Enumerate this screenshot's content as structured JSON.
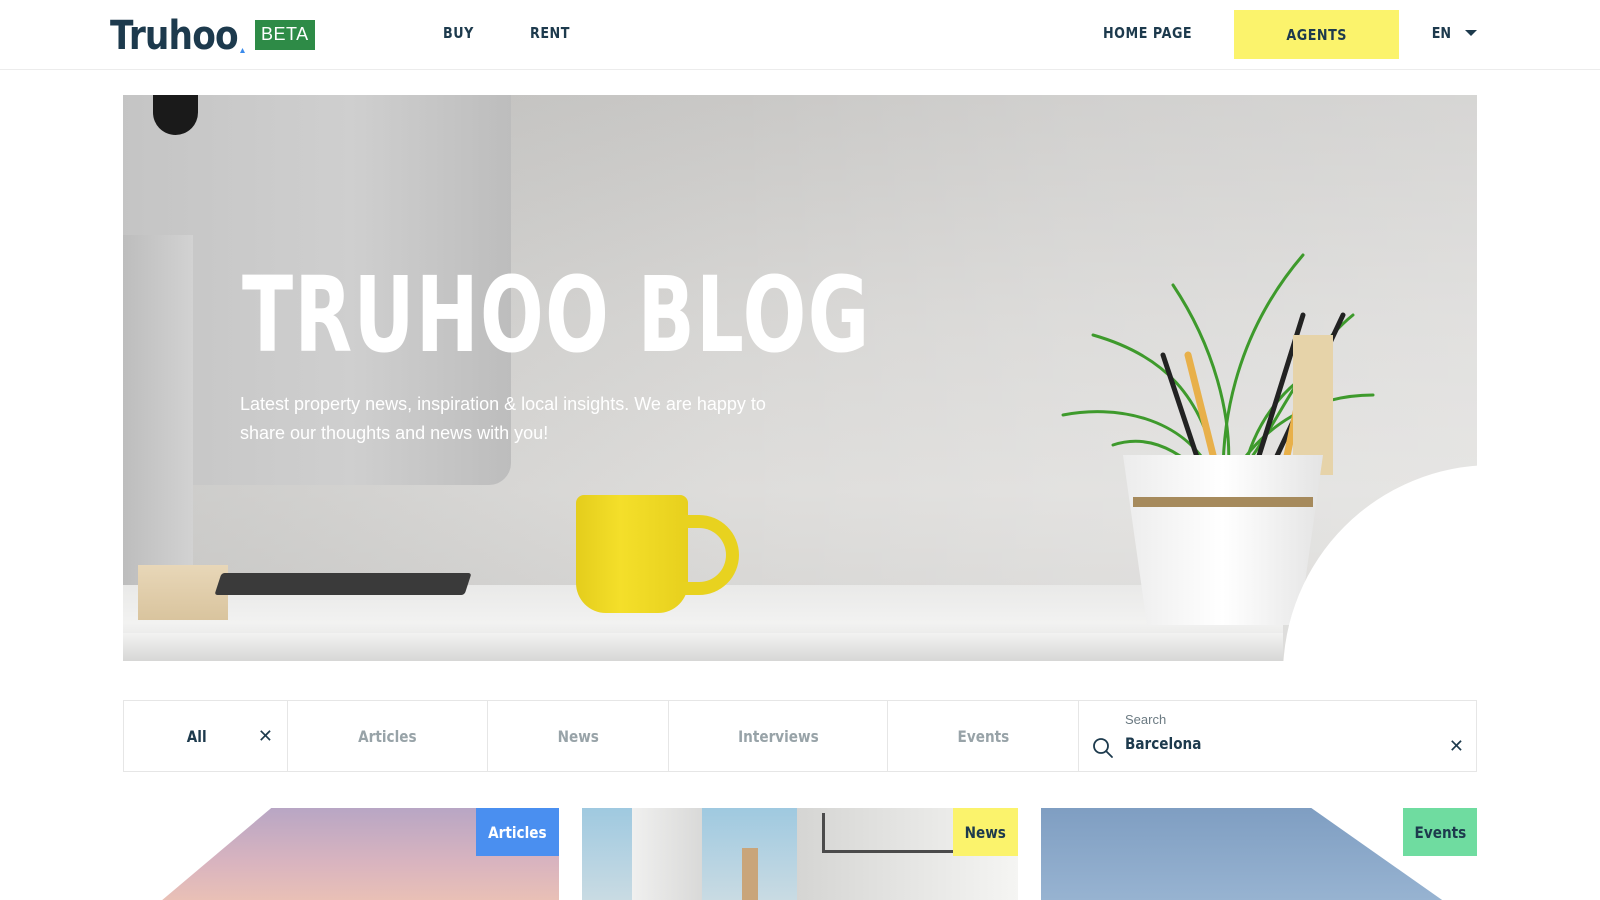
{
  "header": {
    "logo_text": "Truhoo",
    "beta_badge": "BETA",
    "nav": {
      "buy": "BUY",
      "rent": "RENT",
      "home_page": "HOME PAGE",
      "agents": "AGENTS"
    },
    "language": "EN"
  },
  "hero": {
    "title": "TRUHOO BLOG",
    "subtitle": "Latest property news, inspiration & local insights. We are happy to share our thoughts and news with you!"
  },
  "filters": {
    "all": "All",
    "articles": "Articles",
    "news": "News",
    "interviews": "Interviews",
    "events": "Events",
    "active": "All"
  },
  "search": {
    "label": "Search",
    "value": "Barcelona"
  },
  "cards": [
    {
      "tag": "Articles",
      "tag_color": "#4a8ff0"
    },
    {
      "tag": "News",
      "tag_color": "#fbf36c"
    },
    {
      "tag": "Events",
      "tag_color": "#6fdca0"
    }
  ],
  "colors": {
    "brand_navy": "#1d3a4d",
    "beta_green": "#2e8b47",
    "accent_yellow": "#fbf36c",
    "muted_text": "#98a3a8"
  },
  "icons": {
    "language_dropdown": "chevron-down-icon",
    "clear_filter": "close-icon",
    "search": "search-icon",
    "clear_search": "close-icon"
  }
}
